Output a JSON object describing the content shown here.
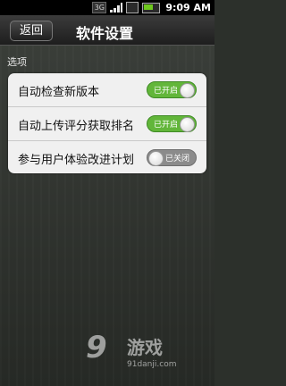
{
  "status_bar": {
    "network": "3G",
    "time": "9:09 AM"
  },
  "header": {
    "back_label": "返回",
    "title": "软件设置"
  },
  "section": {
    "label": "选项"
  },
  "settings": [
    {
      "label": "自动检查新版本",
      "state": "on",
      "state_label": "已开启"
    },
    {
      "label": "自动上传评分获取排名",
      "state": "on",
      "state_label": "已开启"
    },
    {
      "label": "参与用户体验改进计划",
      "state": "off",
      "state_label": "已关闭"
    }
  ],
  "watermark": {
    "logo": "9",
    "text": "游戏",
    "url": "91danji.com"
  },
  "colors": {
    "toggle_on": "#62b63a",
    "toggle_off": "#8b8b8b",
    "panel_bg": "#f0f0f0"
  }
}
